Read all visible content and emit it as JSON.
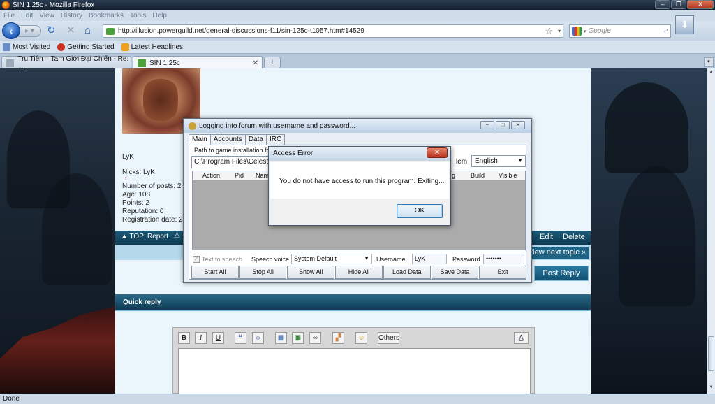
{
  "browser": {
    "window_title": "SIN 1.25c - Mozilla Firefox",
    "menu": [
      "File",
      "Edit",
      "View",
      "History",
      "Bookmarks",
      "Tools",
      "Help"
    ],
    "url": "http://illusion.powerguild.net/general-discussions-f11/sin-125c-t1057.htm#14529",
    "search_placeholder": "Google",
    "bookmarks": [
      "Most Visited",
      "Getting Started",
      "Latest Headlines"
    ],
    "tabs": [
      {
        "label": "Tru Tiên – Tam Giới Đại Chiến - Re: ...",
        "active": false
      },
      {
        "label": "SIN 1.25c",
        "active": true
      }
    ],
    "status": "Done"
  },
  "forum": {
    "username": "LyK",
    "info": {
      "nicks": "Nicks: LyK",
      "posts": "Number of posts: 2",
      "age": "Age: 108",
      "points": "Points: 2",
      "reputation": "Reputation: 0",
      "registration": "Registration date: 20"
    },
    "actions": {
      "top": "▲ TOP",
      "report": "Report",
      "edit": "Edit",
      "delete": "Delete"
    },
    "view_next": "View next topic »",
    "post_reply": "Post Reply",
    "quick_reply": "Quick reply",
    "editor_buttons": {
      "bold": "B",
      "italic": "I",
      "underline": "U",
      "others": "Others"
    }
  },
  "app": {
    "title": "Logging into forum with username and password...",
    "tabs": [
      "Main",
      "Accounts",
      "Data",
      "IRC"
    ],
    "path_label": "Path to game installation folder",
    "path_value": "C:\\Program Files\\Celestial",
    "language_label": "lem",
    "language_value": "English",
    "columns": [
      "Action",
      "Pid",
      "Name",
      "g",
      "Build",
      "Visible"
    ],
    "text_to_speech": "Text to speech",
    "speech_voice_label": "Speech voice",
    "speech_voice_value": "System Default",
    "username_label": "Username",
    "username_value": "LyK",
    "password_label": "Password",
    "password_value": "•••••••",
    "buttons": [
      "Start All",
      "Stop All",
      "Show All",
      "Hide All",
      "Load Data",
      "Save Data",
      "Exit"
    ]
  },
  "dialog": {
    "title": "Access Error",
    "message": "You do not have access to run this program.  Exiting...",
    "ok": "OK"
  }
}
